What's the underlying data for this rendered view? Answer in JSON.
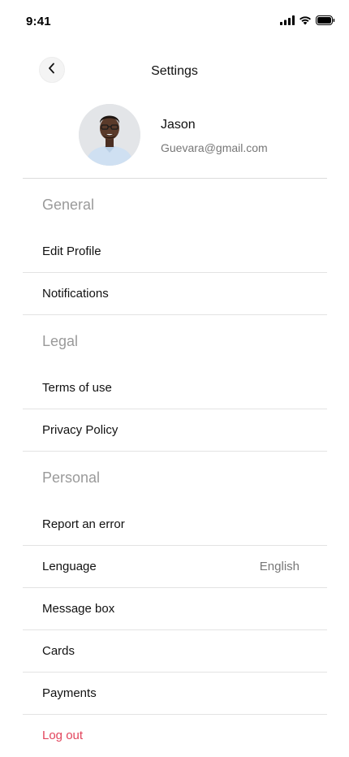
{
  "status_bar": {
    "time": "9:41"
  },
  "header": {
    "title": "Settings"
  },
  "profile": {
    "name": "Jason",
    "email": "Guevara@gmail.com"
  },
  "sections": {
    "general": {
      "title": "General",
      "items": [
        "Edit Profile",
        "Notifications"
      ]
    },
    "legal": {
      "title": "Legal",
      "items": [
        "Terms of use",
        "Privacy Policy"
      ]
    },
    "personal": {
      "title": "Personal",
      "items": [
        "Report an error",
        "Lenguage",
        "Message box",
        "Cards",
        "Payments"
      ],
      "language_value": "English"
    }
  },
  "logout_label": "Log out",
  "colors": {
    "accent_logout": "#e2445c",
    "section_header": "#9a9a9a",
    "divider": "#e3e3e3"
  }
}
